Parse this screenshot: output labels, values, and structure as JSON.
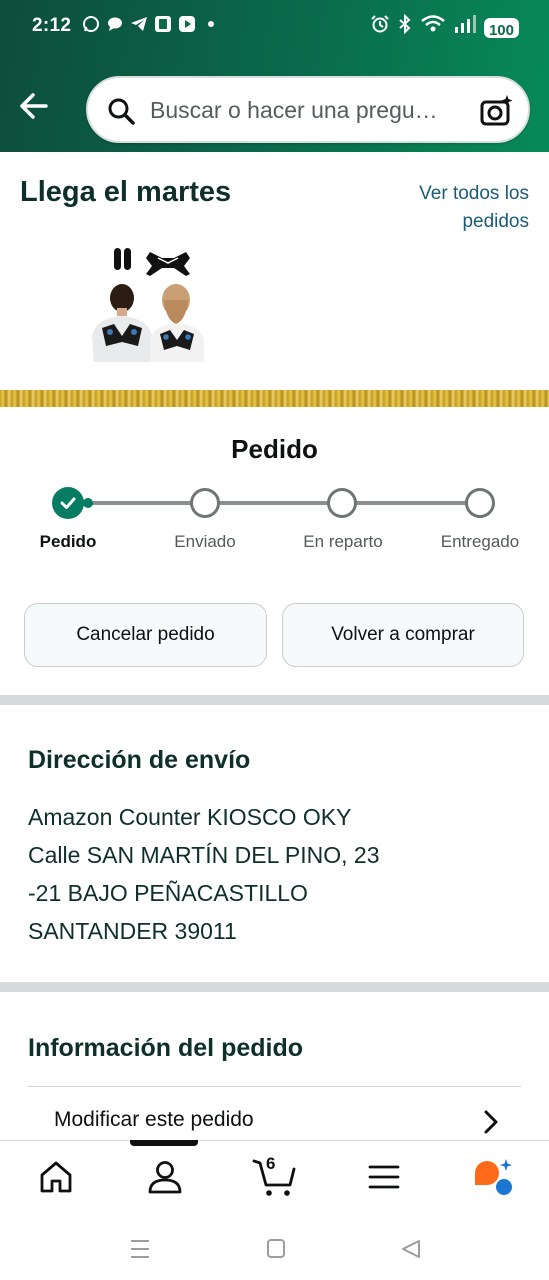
{
  "status_bar": {
    "time": "2:12",
    "notification_icons": [
      "whatsapp-icon",
      "chat-bubble-icon",
      "telegram-icon",
      "sim-icon",
      "play-icon"
    ],
    "battery": "100"
  },
  "header": {
    "search_placeholder": "Buscar o hacer una pregu…"
  },
  "delivery": {
    "arrives": "Llega el martes",
    "see_all_orders": "Ver todos los pedidos"
  },
  "progress": {
    "title": "Pedido",
    "steps": [
      "Pedido",
      "Enviado",
      "En reparto",
      "Entregado"
    ],
    "current_step": 1
  },
  "actions": {
    "cancel": "Cancelar pedido",
    "buy_again": "Volver a comprar"
  },
  "shipping": {
    "title": "Dirección de envío",
    "lines": [
      "Amazon Counter KIOSCO OKY",
      "Calle SAN MARTÍN DEL PINO, 23",
      "-21 BAJO PEÑACASTILLO",
      "SANTANDER 39011"
    ]
  },
  "order_info": {
    "title": "Información del pedido",
    "modify": "Modificar este pedido"
  },
  "bottom_nav": {
    "cart_count": "6",
    "items": [
      "home-icon",
      "account-icon",
      "cart-icon",
      "menu-icon",
      "rufus-ai-icon"
    ]
  },
  "colors": {
    "header_green": "#0a6b4b",
    "progress_green": "#067d62",
    "link_blue": "#1a5c7a",
    "ai_orange": "#ff6a1a",
    "ai_blue": "#1b77d2"
  }
}
